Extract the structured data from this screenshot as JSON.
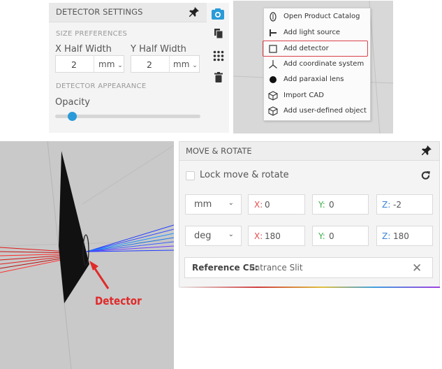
{
  "detector_settings": {
    "title": "DETECTOR SETTINGS",
    "size_section": "SIZE PREFERENCES",
    "x_half_width_label": "X Half Width",
    "y_half_width_label": "Y Half Width",
    "x_half_width_value": "2",
    "y_half_width_value": "2",
    "x_unit": "mm",
    "y_unit": "mm",
    "appearance_section": "DETECTOR APPEARANCE",
    "opacity_label": "Opacity",
    "opacity_fraction": 0.12,
    "icons": [
      "pin-icon",
      "camera-icon",
      "copy-icon",
      "grid-icon",
      "trash-icon"
    ]
  },
  "context_menu": {
    "items": [
      {
        "label": "Open Product Catalog",
        "icon": "catalog-icon"
      },
      {
        "label": "Add light source",
        "icon": "light-source-icon"
      },
      {
        "label": "Add detector",
        "icon": "detector-icon",
        "highlighted": true
      },
      {
        "label": "Add coordinate system",
        "icon": "coordinate-system-icon"
      },
      {
        "label": "Add paraxial lens",
        "icon": "paraxial-lens-icon"
      },
      {
        "label": "Import CAD",
        "icon": "cad-icon"
      },
      {
        "label": "Add user-defined object",
        "icon": "user-object-icon"
      }
    ],
    "highlight_color": "#d9414b"
  },
  "scene": {
    "annotation": "Detector",
    "annotation_color": "#e02a2a"
  },
  "move_rotate": {
    "title": "MOVE & ROTATE",
    "lock_label": "Lock move & rotate",
    "lock_checked": false,
    "translation": {
      "unit": "mm",
      "x_axis": "X:",
      "x": "0",
      "y_axis": "Y:",
      "y": "0",
      "z_axis": "Z:",
      "z": "-2"
    },
    "rotation": {
      "unit": "deg",
      "x_axis": "X:",
      "x": "180",
      "y_axis": "Y:",
      "y": "0",
      "z_axis": "Z:",
      "z": "180"
    },
    "reference_label": "Reference CS:",
    "reference_value": "Entrance Slit",
    "axis_colors": {
      "x": "#e05050",
      "y": "#3fae4a",
      "z": "#3b82d6"
    }
  },
  "colors": {
    "accent": "#2a9bd8"
  }
}
